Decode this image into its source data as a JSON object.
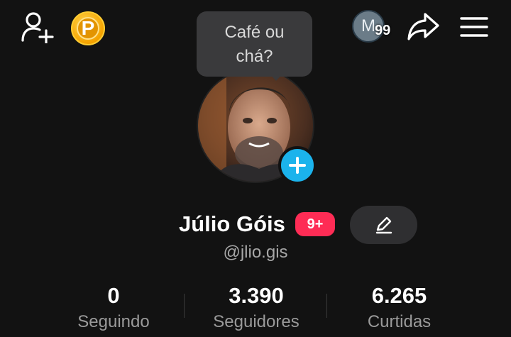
{
  "header": {
    "coin_letter": "P",
    "avatar_initial": "M",
    "avatar_badge": "99"
  },
  "tooltip": {
    "line1": "Café ou",
    "line2": "chá?"
  },
  "profile": {
    "name": "Júlio Góis",
    "notification_badge": "9+",
    "handle": "@jlio.gis"
  },
  "stats": [
    {
      "value": "0",
      "label": "Seguindo"
    },
    {
      "value": "3.390",
      "label": "Seguidores"
    },
    {
      "value": "6.265",
      "label": "Curtidas"
    }
  ],
  "colors": {
    "background": "#121212",
    "accent_blue": "#1bb3ec",
    "badge_pink": "#fe2c55",
    "coin_gold": "#f5a300"
  },
  "icons": {
    "top_left": "add-user-icon",
    "coin": "coin-icon",
    "share": "share-icon",
    "menu": "menu-icon",
    "edit": "pencil-icon",
    "add_photo": "plus-icon"
  }
}
